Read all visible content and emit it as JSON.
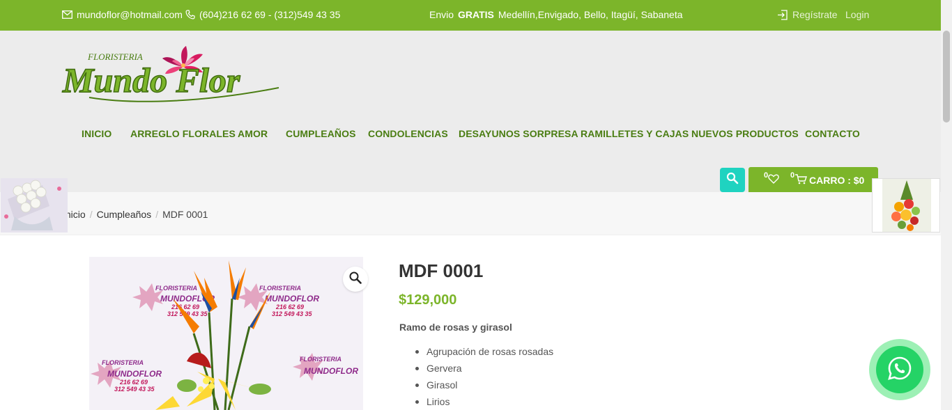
{
  "topbar": {
    "email": "mundoflor@hotmail.com",
    "phones": "(604)216 62 69 - (312)549 43 35",
    "shipping_prefix": "Envio",
    "shipping_bold": "GRATIS",
    "shipping_cities": "Medellín,Envigado, Bello, Itagüí, Sabaneta",
    "register": "Regístrate",
    "login": "Login",
    "icons": [
      "envelope-icon",
      "phone-icon",
      "sign-in-icon"
    ]
  },
  "logo": {
    "small": "FLORISTERIA",
    "big": "Mundo Flor"
  },
  "nav": [
    "INICIO",
    "ARREGLO FLORALES",
    "AMOR",
    "CUMPLEAÑOS",
    "CONDOLENCIAS",
    "DESAYUNOS SORPRESA",
    "RAMILLETES Y CAJAS",
    "NUEVOS PRODUCTOS",
    "CONTACTO"
  ],
  "cart": {
    "wishlist_count": "0",
    "cart_count": "0",
    "label": "CARRO : $0"
  },
  "breadcrumb": {
    "home": "Inicio",
    "category": "Cumpleaños",
    "current": "MDF 0001"
  },
  "product": {
    "title": "MDF 0001",
    "price": "$129,000",
    "description": "Ramo de rosas y girasol",
    "features": [
      "Agrupación de rosas rosadas",
      "Gervera",
      "Girasol",
      "Lirios"
    ]
  },
  "watermark": {
    "brand": "FLORISTERIA",
    "name": "MUNDOFLOR",
    "phone1": "216 62 69",
    "phone2": "312 549 43 35"
  },
  "colors": {
    "brand_green": "#7cb52a",
    "nav_green": "#4a7d12",
    "search_teal": "#1fd3c0",
    "whatsapp": "#25d366"
  }
}
